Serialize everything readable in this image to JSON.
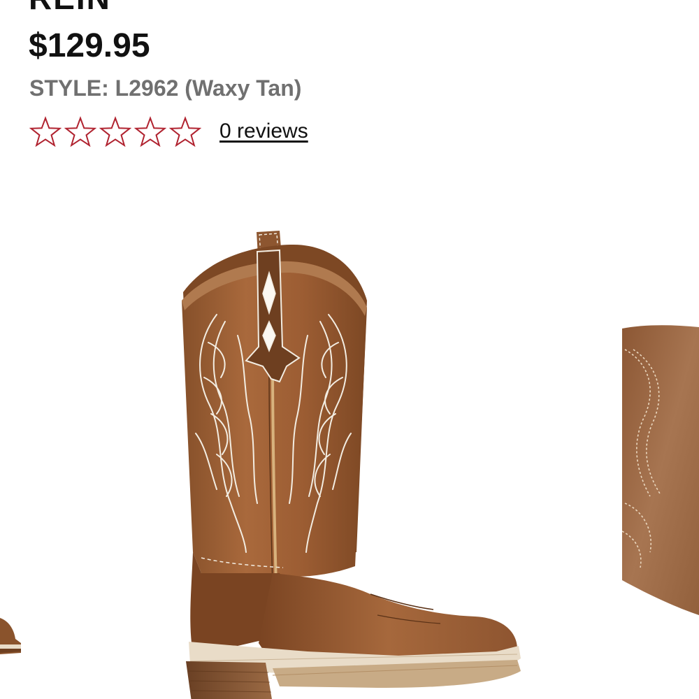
{
  "product": {
    "name": "REIN",
    "price": "$129.95",
    "style_label": "STYLE:",
    "style_value": "L2962 (Waxy Tan)"
  },
  "rating": {
    "stars_filled": 0,
    "stars_total": 5,
    "reviews_label": "0 reviews"
  },
  "colors": {
    "star_outline": "#b0222f",
    "boot_leather": "#9a5e34",
    "boot_dark": "#6e3f20",
    "stitching": "#f3ede2",
    "text_primary": "#111111",
    "text_secondary": "#707070"
  },
  "gallery": {
    "images": [
      {
        "name": "previous-image-partial"
      },
      {
        "name": "main-boot-image"
      },
      {
        "name": "next-image-partial"
      }
    ]
  }
}
